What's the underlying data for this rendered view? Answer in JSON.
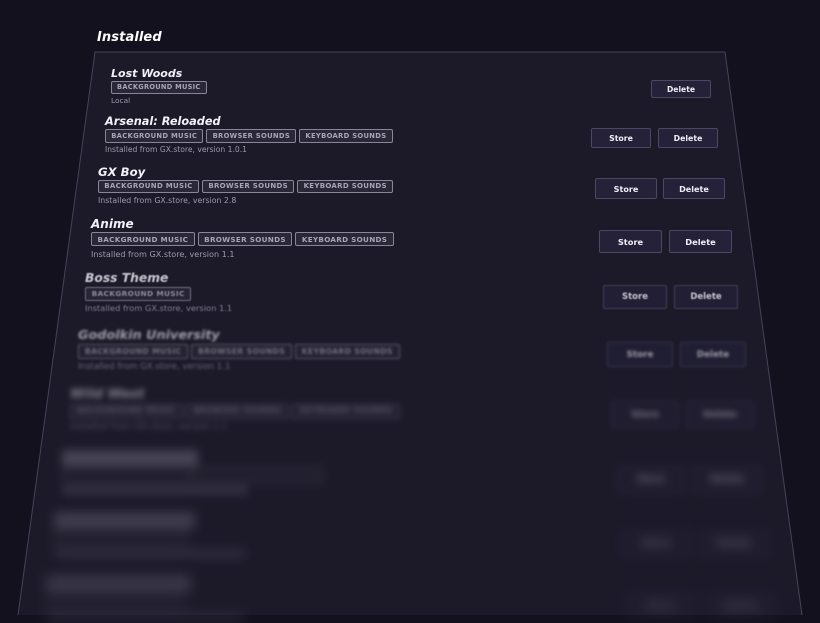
{
  "section": {
    "title": "Installed"
  },
  "items": [
    {
      "name": "Lost Woods",
      "tags": [
        "BACKGROUND MUSIC"
      ],
      "source": "Local",
      "has_store": false
    },
    {
      "name": "Arsenal: Reloaded",
      "tags": [
        "BACKGROUND MUSIC",
        "BROWSER SOUNDS",
        "KEYBOARD SOUNDS"
      ],
      "source": "Installed from GX.store, version 1.0.1",
      "has_store": true
    },
    {
      "name": "GX Boy",
      "tags": [
        "BACKGROUND MUSIC",
        "BROWSER SOUNDS",
        "KEYBOARD SOUNDS"
      ],
      "source": "Installed from GX.store, version 2.8",
      "has_store": true
    },
    {
      "name": "Anime",
      "tags": [
        "BACKGROUND MUSIC",
        "BROWSER SOUNDS",
        "KEYBOARD SOUNDS"
      ],
      "source": "Installed from GX.store, version 1.1",
      "has_store": true
    },
    {
      "name": "Boss Theme",
      "tags": [
        "BACKGROUND MUSIC"
      ],
      "source": "Installed from GX.store, version 1.1",
      "has_store": true
    },
    {
      "name": "Godolkin University",
      "tags": [
        "BACKGROUND MUSIC",
        "BROWSER SOUNDS",
        "KEYBOARD SOUNDS"
      ],
      "source": "Installed from GX.store, version 1.1",
      "has_store": true
    },
    {
      "name": "Wild West",
      "tags": [
        "BACKGROUND MUSIC",
        "BROWSER SOUNDS",
        "KEYBOARD SOUNDS"
      ],
      "source": "Installed from GX.store, version 1.1",
      "has_store": true
    },
    {
      "name": "",
      "tags": [
        "",
        ""
      ],
      "source": "",
      "has_store": true
    },
    {
      "name": "",
      "tags": [
        ""
      ],
      "source": "",
      "has_store": true
    },
    {
      "name": "",
      "tags": [
        ""
      ],
      "source": "",
      "has_store": true
    }
  ],
  "buttons": {
    "store_label": "Store",
    "delete_label": "Delete"
  },
  "colors": {
    "background": "#13111d",
    "panel": "#1c1a29",
    "button": "#242138",
    "tag_border": "#8a8698"
  }
}
